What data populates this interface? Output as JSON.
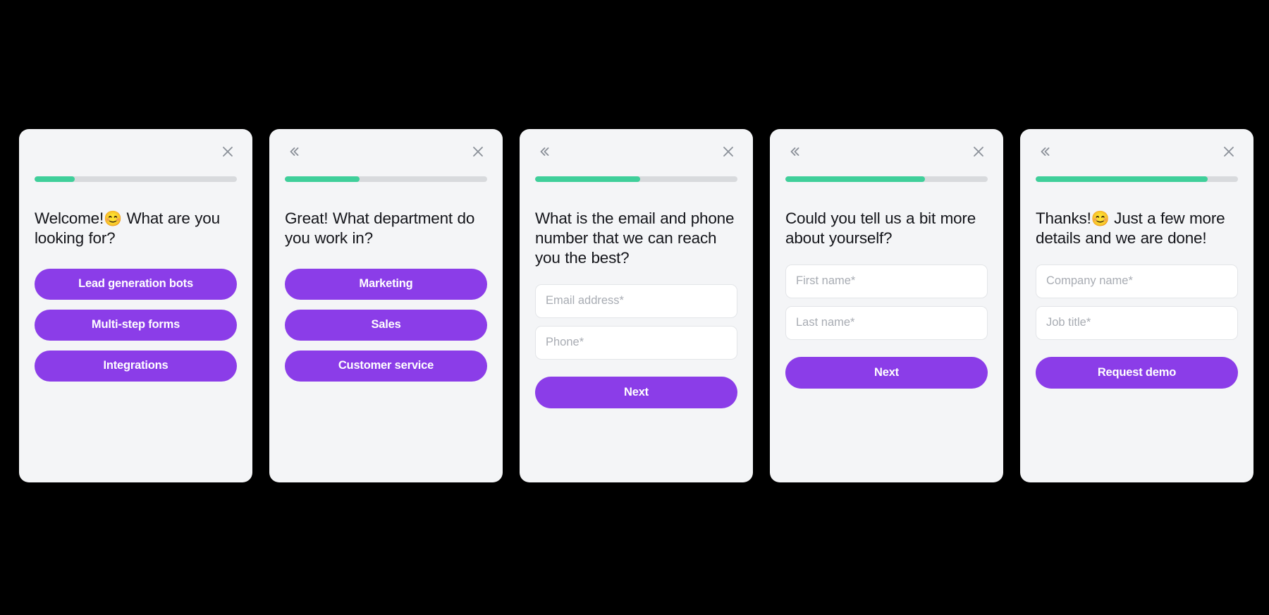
{
  "theme": {
    "page_background": "#000000",
    "card_background": "#f4f5f7",
    "accent_purple": "#8b3de8",
    "progress_green": "#3fcf9a",
    "progress_track": "#d8dadd",
    "text_color": "#14151a",
    "placeholder_color": "#a8acb3"
  },
  "icons": {
    "close": "close-icon",
    "back": "double-chevron-left-icon"
  },
  "cards": [
    {
      "id": "step-1-interest",
      "has_back": false,
      "progress_percent": 20,
      "question_pre": "Welcome!",
      "emoji": "😊",
      "question_post": " What are you looking for?",
      "type": "options",
      "options": [
        {
          "label": "Lead generation bots"
        },
        {
          "label": "Multi-step forms"
        },
        {
          "label": "Integrations"
        }
      ]
    },
    {
      "id": "step-2-department",
      "has_back": true,
      "progress_percent": 37,
      "question_pre": "Great! What department do you work in?",
      "emoji": "",
      "question_post": "",
      "type": "options",
      "options": [
        {
          "label": "Marketing"
        },
        {
          "label": "Sales"
        },
        {
          "label": "Customer service"
        }
      ]
    },
    {
      "id": "step-3-contact",
      "has_back": true,
      "progress_percent": 52,
      "question_pre": "What is the email and phone number that we can reach you the best?",
      "emoji": "",
      "question_post": "",
      "type": "form",
      "fields": [
        {
          "name": "email-field",
          "placeholder": "Email address*",
          "value": ""
        },
        {
          "name": "phone-field",
          "placeholder": "Phone*",
          "value": ""
        }
      ],
      "submit_label": "Next"
    },
    {
      "id": "step-4-name",
      "has_back": true,
      "progress_percent": 69,
      "question_pre": "Could you tell us a bit more about yourself?",
      "emoji": "",
      "question_post": "",
      "type": "form",
      "fields": [
        {
          "name": "first-name-field",
          "placeholder": "First name*",
          "value": ""
        },
        {
          "name": "last-name-field",
          "placeholder": "Last name*",
          "value": ""
        }
      ],
      "submit_label": "Next"
    },
    {
      "id": "step-5-company",
      "has_back": true,
      "progress_percent": 85,
      "question_pre": "Thanks!",
      "emoji": "😊",
      "question_post": " Just a few more details and we are done!",
      "type": "form",
      "fields": [
        {
          "name": "company-name-field",
          "placeholder": "Company name*",
          "value": ""
        },
        {
          "name": "job-title-field",
          "placeholder": "Job title*",
          "value": ""
        }
      ],
      "submit_label": "Request demo"
    }
  ]
}
